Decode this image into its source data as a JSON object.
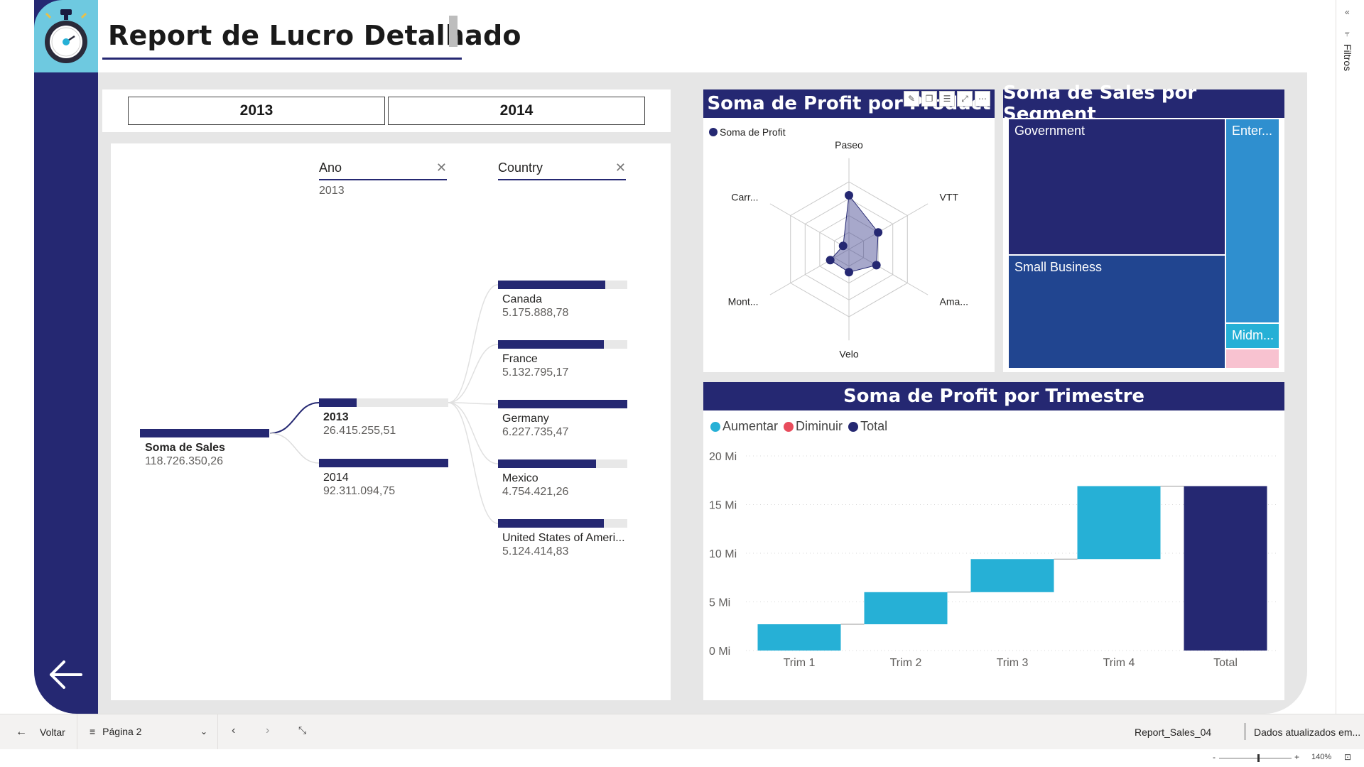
{
  "header": {
    "title": "Report de Lucro Detalhado"
  },
  "slicer": {
    "options": [
      "2013",
      "2014"
    ]
  },
  "tree": {
    "levels": [
      {
        "name": "Ano",
        "selected": "2013"
      },
      {
        "name": "Country",
        "selected": ""
      }
    ],
    "root": {
      "label": "Soma de Sales",
      "value": "118.726.350,26"
    },
    "years": [
      {
        "label": "2013",
        "value": "26.415.255,51",
        "fraction": 0.29
      },
      {
        "label": "2014",
        "value": "92.311.094,75",
        "fraction": 1.0
      }
    ],
    "countries": [
      {
        "label": "Canada",
        "value": "5.175.888,78",
        "fraction": 0.83
      },
      {
        "label": "France",
        "value": "5.132.795,17",
        "fraction": 0.82
      },
      {
        "label": "Germany",
        "value": "6.227.735,47",
        "fraction": 1.0
      },
      {
        "label": "Mexico",
        "value": "4.754.421,26",
        "fraction": 0.76
      },
      {
        "label": "United States of Ameri...",
        "value": "5.124.414,83",
        "fraction": 0.82
      }
    ]
  },
  "radar": {
    "title": "Soma de Profit por Product",
    "legend": "Soma de Profit",
    "axes": [
      "Paseo",
      "VTT",
      "Ama...",
      "Velo",
      "Mont...",
      "Carr..."
    ],
    "values": [
      0.8,
      0.5,
      0.47,
      0.34,
      0.32,
      0.1
    ],
    "color": "#252872",
    "toolbar_icons": [
      "pin-icon",
      "copy-icon",
      "filter-icon",
      "focus-icon",
      "more-icon"
    ]
  },
  "treemap": {
    "title": "Soma de Sales por Segment",
    "cells": [
      {
        "label": "Government",
        "color": "#252872"
      },
      {
        "label": "Small Business",
        "color": "#214590"
      },
      {
        "label": "Enter...",
        "color": "#2f8fcf"
      },
      {
        "label": "Midm...",
        "color": "#26b0d6"
      },
      {
        "label": "",
        "color": "#f8c2d0"
      }
    ]
  },
  "chart_data": {
    "type": "bar",
    "subtype": "waterfall",
    "title": "Soma de Profit por Trimestre",
    "legend": [
      {
        "name": "Aumentar",
        "color": "#26b0d6"
      },
      {
        "name": "Diminuir",
        "color": "#e84c5c"
      },
      {
        "name": "Total",
        "color": "#252872"
      }
    ],
    "categories": [
      "Trim 1",
      "Trim 2",
      "Trim 3",
      "Trim 4",
      "Total"
    ],
    "increments": [
      2.7,
      3.3,
      3.4,
      7.5
    ],
    "total": 16.9,
    "yticks": [
      "0 Mi",
      "5 Mi",
      "10 Mi",
      "15 Mi",
      "20 Mi"
    ],
    "ylim": [
      0,
      20
    ]
  },
  "statusbar": {
    "back_label": "Voltar",
    "page_label": "Página 2",
    "file_name": "Report_Sales_04",
    "updated_label": "Dados atualizados em...",
    "zoom": "140%"
  },
  "filters": {
    "label": "Filtros"
  }
}
